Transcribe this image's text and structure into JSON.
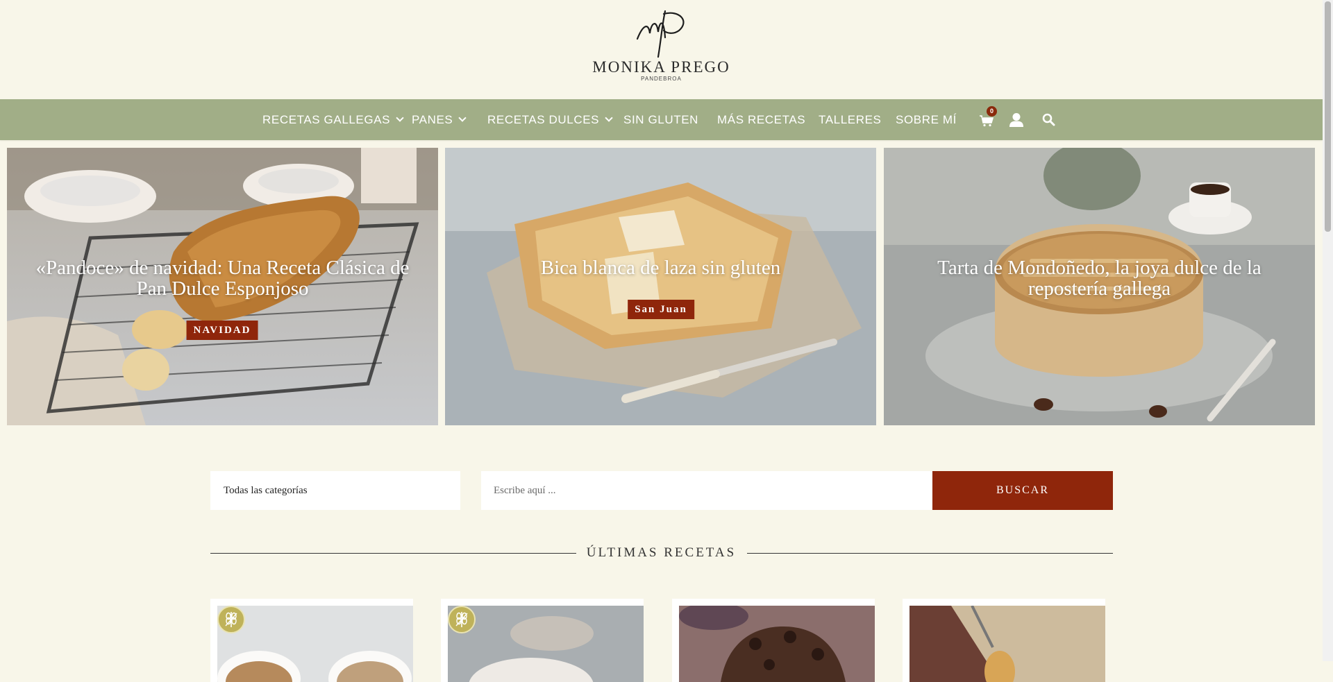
{
  "brand": {
    "name": "MONIKA PREGO",
    "sub": "PANDEBROA"
  },
  "nav": {
    "items": [
      {
        "label": "RECETAS GALLEGAS",
        "dropdown": true
      },
      {
        "label": "PANES",
        "dropdown": true
      },
      {
        "label": "RECETAS DULCES",
        "dropdown": true
      },
      {
        "label": "SIN GLUTEN",
        "dropdown": false
      },
      {
        "label": "MÁS RECETAS",
        "dropdown": false
      },
      {
        "label": "TALLERES",
        "dropdown": false
      },
      {
        "label": "SOBRE MÍ",
        "dropdown": false
      }
    ],
    "cart_count": "0",
    "icons": [
      "cart-icon",
      "user-icon",
      "search-icon"
    ]
  },
  "hero": [
    {
      "title": "«Pandoce» de navidad: Una Receta Clásica de Pan Dulce Esponjoso",
      "tag": "NAVIDAD"
    },
    {
      "title": "Bica blanca de laza sin gluten",
      "tag": "San Juan"
    },
    {
      "title": "Tarta de Mondoñedo, la joya dulce de la repostería gallega",
      "tag": ""
    }
  ],
  "search": {
    "category_selected": "Todas las categorías",
    "placeholder": "Escribe aquí ...",
    "button_label": "BUSCAR"
  },
  "latest": {
    "title": "ÚLTIMAS RECETAS",
    "cards": [
      {
        "gluten_free": true
      },
      {
        "gluten_free": true
      },
      {
        "gluten_free": false
      },
      {
        "gluten_free": false
      }
    ]
  },
  "colors": {
    "background": "#f8f6e9",
    "nav": "#a1ae87",
    "accent": "#8f260b",
    "gluten_badge": "#bfb25a"
  }
}
